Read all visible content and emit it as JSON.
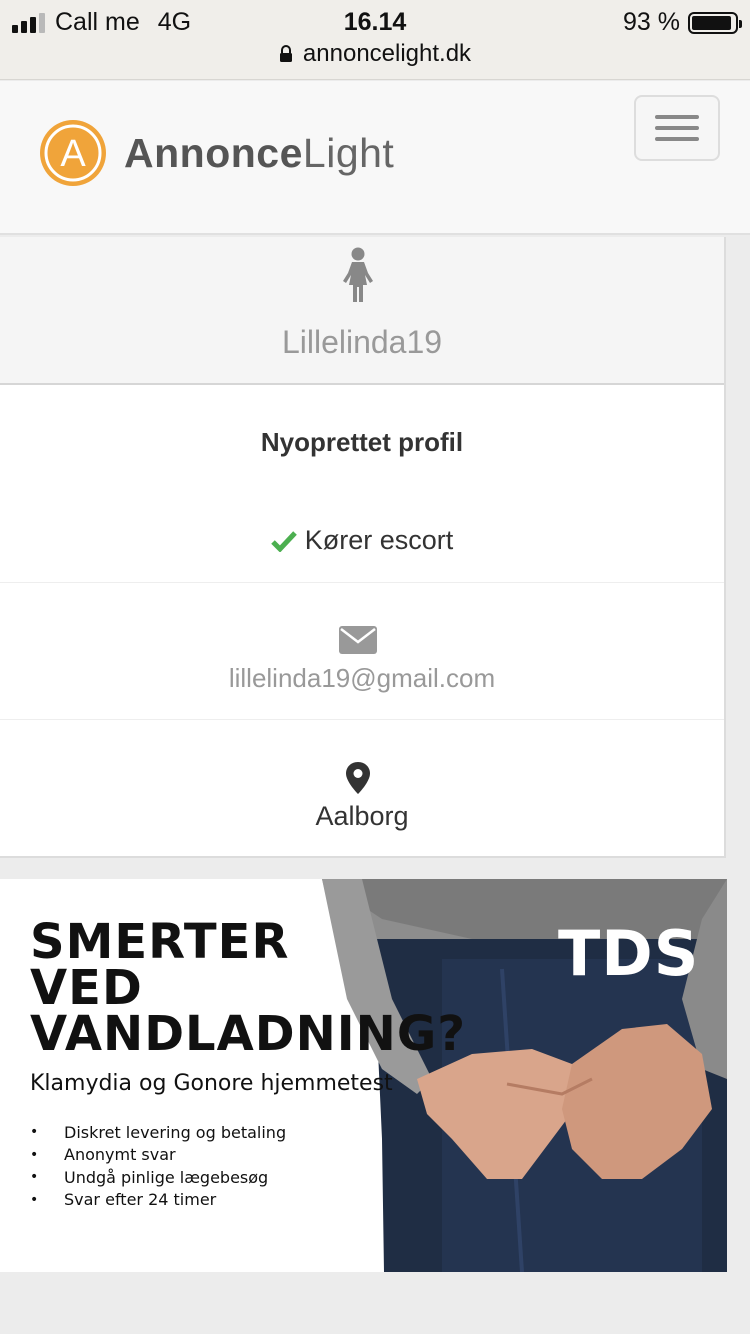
{
  "status_bar": {
    "carrier": "Call me",
    "network": "4G",
    "time": "16.14",
    "battery": "93 %",
    "battery_level": 0.93,
    "url": "annoncelight.dk"
  },
  "header": {
    "logo_bold": "Annonce",
    "logo_light": "Light",
    "logo_letter": "A",
    "brand_color": "#f0a43a"
  },
  "profile": {
    "username": "Lillelinda19",
    "status_title": "Nyoprettet profil",
    "escort_label": "Kører escort",
    "email": "lillelinda19@gmail.com",
    "city": "Aalborg",
    "check_color": "#4caf50"
  },
  "ad": {
    "headline_lines": [
      "SMERTER",
      "VED",
      "VANDLADNING?"
    ],
    "subtitle": "Klamydia og Gonore hjemmetest",
    "bullets": [
      "Diskret levering og betaling",
      "Anonymt svar",
      "Undgå pinlige lægebesøg",
      "Svar efter 24 timer"
    ],
    "brand": "TDS"
  }
}
